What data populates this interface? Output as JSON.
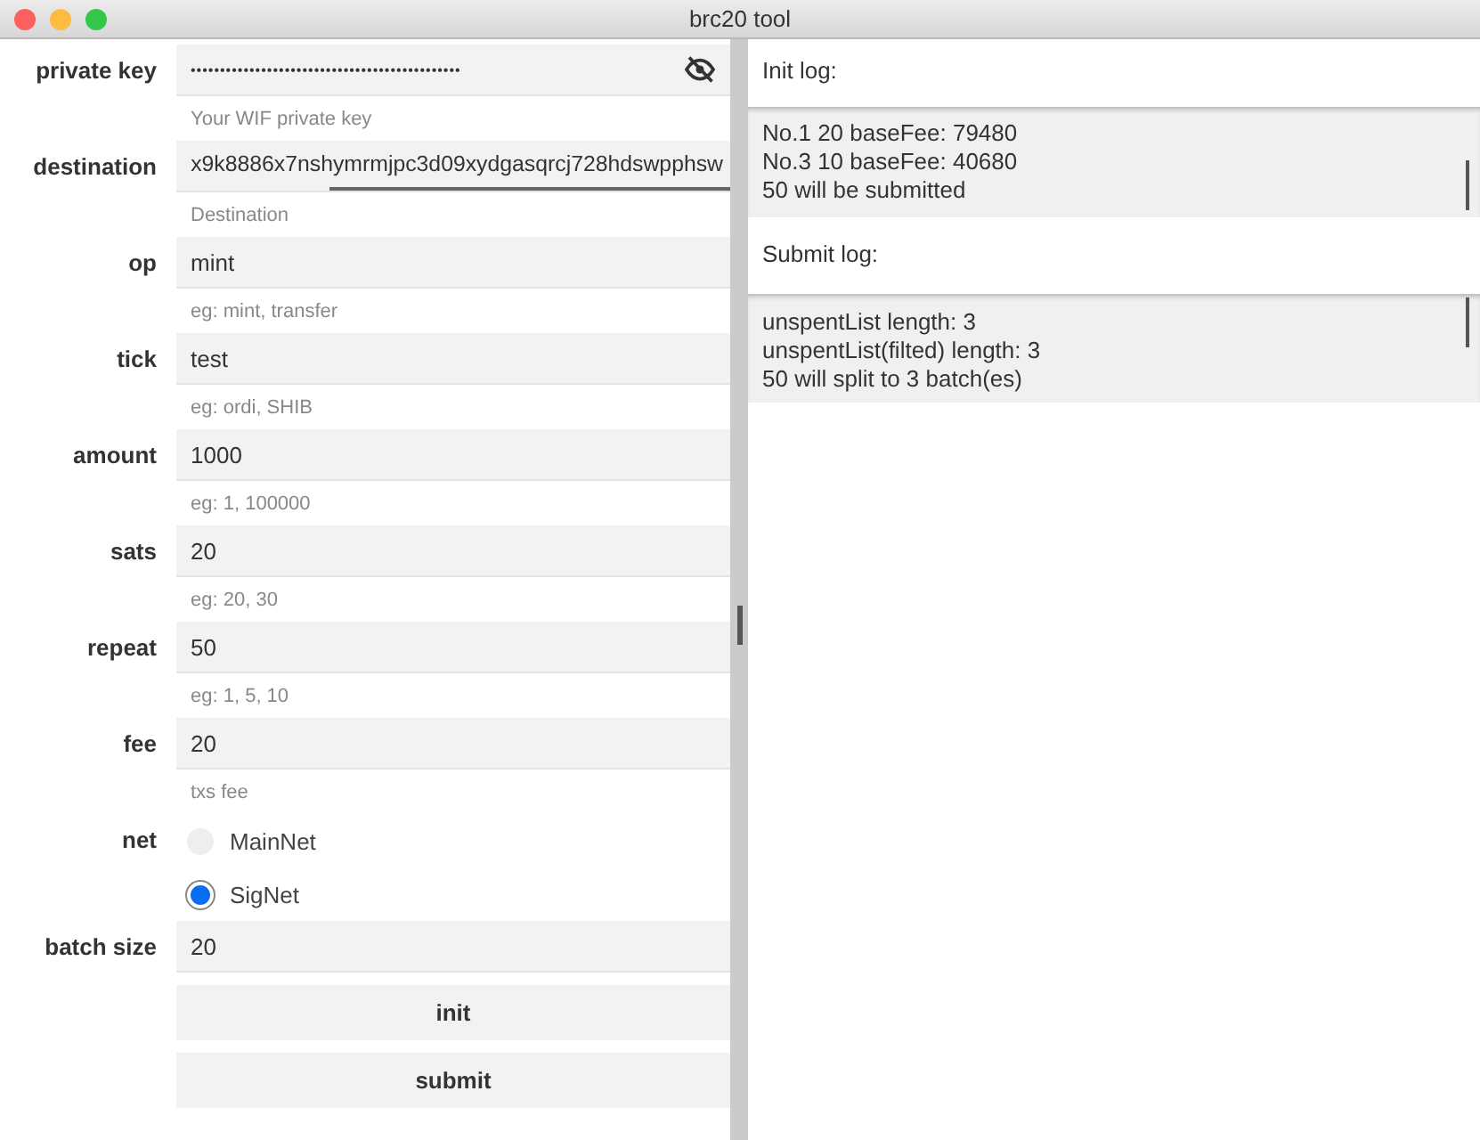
{
  "window": {
    "title": "brc20 tool"
  },
  "form": [
    {
      "kind": "password",
      "label": "private key",
      "value": "••••••••••••••••••••••••••••••••••••••••••••••",
      "hint": "Your WIF private key"
    },
    {
      "kind": "scrolled",
      "label": "destination",
      "value": "x9k8886x7nshymrmjpc3d09xydgasqrcj728hdswpphsw",
      "hint": "Destination"
    },
    {
      "kind": "text",
      "label": "op",
      "value": "mint",
      "hint": "eg: mint, transfer"
    },
    {
      "kind": "text",
      "label": "tick",
      "value": "test",
      "hint": "eg: ordi, SHIB"
    },
    {
      "kind": "text",
      "label": "amount",
      "value": "1000",
      "hint": "eg: 1, 100000"
    },
    {
      "kind": "text",
      "label": "sats",
      "value": "20",
      "hint": "eg: 20, 30"
    },
    {
      "kind": "text",
      "label": "repeat",
      "value": "50",
      "hint": "eg: 1, 5, 10"
    },
    {
      "kind": "text",
      "label": "fee",
      "value": "20",
      "hint": "txs fee"
    },
    {
      "kind": "radio",
      "label": "net",
      "options": [
        {
          "label": "MainNet",
          "selected": false
        },
        {
          "label": "SigNet",
          "selected": true
        }
      ]
    },
    {
      "kind": "text",
      "label": "batch size",
      "value": "20"
    }
  ],
  "buttons": [
    "init",
    "submit"
  ],
  "logs": [
    {
      "title": "Init log:",
      "lines": [
        "No.1 20 baseFee: 79480",
        "No.3 10 baseFee: 40680",
        "50 will be submitted"
      ]
    },
    {
      "title": "Submit log:",
      "lines": [
        "unspentList length: 3",
        "unspentList(filted) length: 3",
        "50 will split to 3 batch(es)"
      ]
    }
  ]
}
